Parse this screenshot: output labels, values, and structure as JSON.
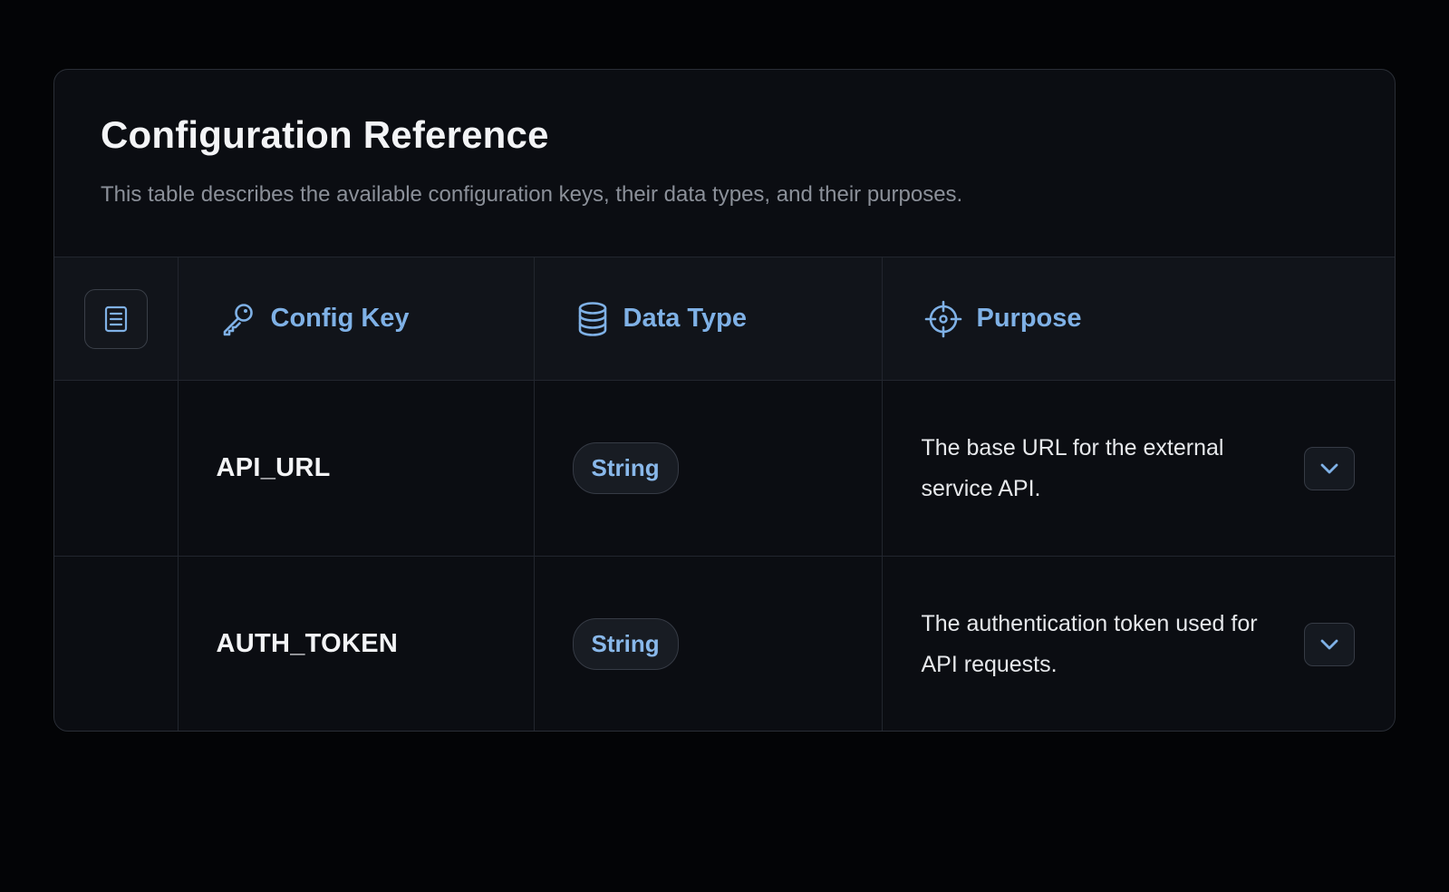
{
  "header": {
    "title": "Configuration Reference",
    "subtitle": "This table describes the available configuration keys, their data types, and their purposes."
  },
  "table": {
    "columns": [
      {
        "label": "",
        "icon": "document-icon"
      },
      {
        "label": "Config Key",
        "icon": "key-icon"
      },
      {
        "label": "Data Type",
        "icon": "database-icon"
      },
      {
        "label": "Purpose",
        "icon": "crosshair-icon"
      }
    ],
    "rows": [
      {
        "key": "API_URL",
        "type": "String",
        "purpose": "The base URL for the external service API."
      },
      {
        "key": "AUTH_TOKEN",
        "type": "String",
        "purpose": "The authentication token used for API requests."
      }
    ]
  },
  "colors": {
    "background": "#030406",
    "card": "#0b0d12",
    "accent": "#7fb1e6",
    "text": "#f3f4f6",
    "muted": "#8b9099"
  }
}
